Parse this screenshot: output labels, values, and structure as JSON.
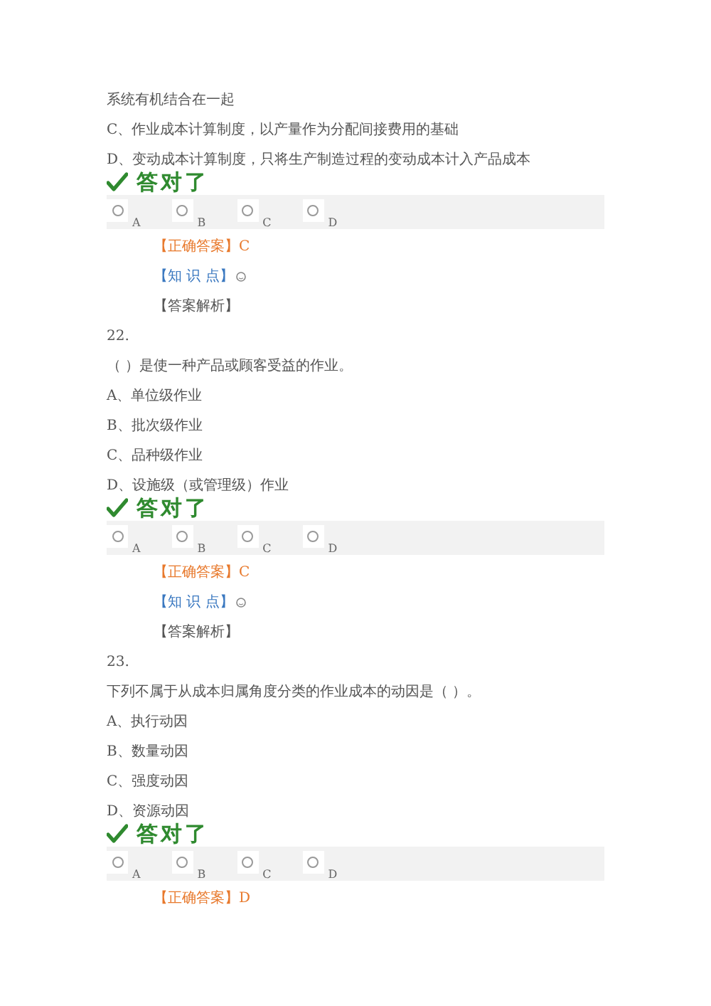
{
  "questions": [
    {
      "lines": [
        "系统有机结合在一起",
        "C、作业成本计算制度，以产量作为分配间接费用的基础",
        "D、变动成本计算制度，只将生产制造过程的变动成本计入产品成本"
      ],
      "verdict": "答对了",
      "choices": [
        {
          "label": "A",
          "selected": false
        },
        {
          "label": "B",
          "selected": false
        },
        {
          "label": "C",
          "selected": false
        },
        {
          "label": "D",
          "selected": false
        }
      ],
      "correct_answer": "【正确答案】C",
      "knowledge_point": "【知 识 点】",
      "analysis": "【答案解析】"
    },
    {
      "number": "22.",
      "lines": [
        "（ ）是使一种产品或顾客受益的作业。",
        "A、单位级作业",
        "B、批次级作业",
        "C、品种级作业",
        "D、设施级（或管理级）作业"
      ],
      "verdict": "答对了",
      "choices": [
        {
          "label": "A",
          "selected": false
        },
        {
          "label": "B",
          "selected": false
        },
        {
          "label": "C",
          "selected": false
        },
        {
          "label": "D",
          "selected": false
        }
      ],
      "correct_answer": "【正确答案】C",
      "knowledge_point": "【知 识 点】",
      "analysis": "【答案解析】"
    },
    {
      "number": "23.",
      "lines": [
        "下列不属于从成本归属角度分类的作业成本的动因是（ ）。",
        "A、执行动因",
        "B、数量动因",
        "C、强度动因",
        "D、资源动因"
      ],
      "verdict": "答对了",
      "choices": [
        {
          "label": "A",
          "selected": false
        },
        {
          "label": "B",
          "selected": false
        },
        {
          "label": "C",
          "selected": false
        },
        {
          "label": "D",
          "selected": false
        }
      ],
      "correct_answer": "【正确答案】D"
    }
  ]
}
